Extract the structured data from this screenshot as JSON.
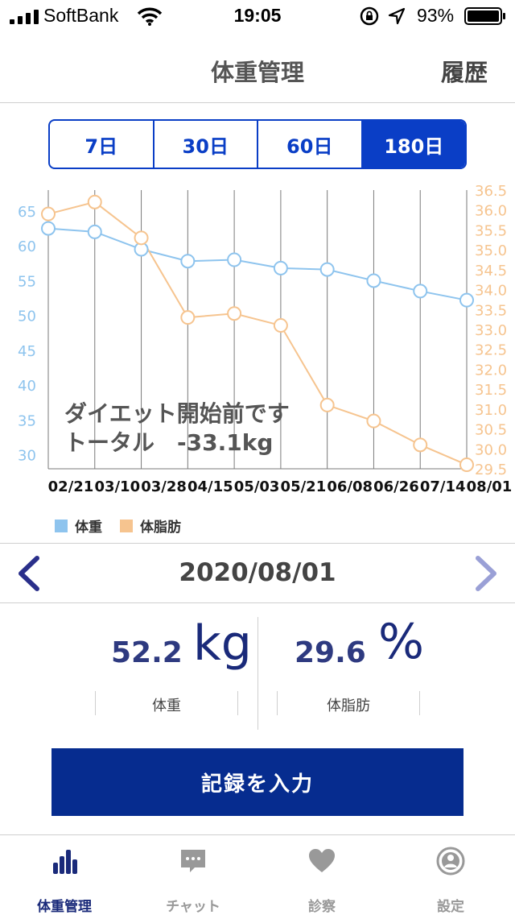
{
  "status_bar": {
    "carrier": "SoftBank",
    "time": "19:05",
    "battery": "93%"
  },
  "header": {
    "title": "体重管理",
    "history_label": "履歴"
  },
  "period_tabs": [
    {
      "label": "7日",
      "active": false
    },
    {
      "label": "30日",
      "active": false
    },
    {
      "label": "60日",
      "active": false
    },
    {
      "label": "180日",
      "active": true
    }
  ],
  "chart_data": {
    "type": "line",
    "categories": [
      "02/21",
      "03/10",
      "03/28",
      "04/15",
      "05/03",
      "05/21",
      "06/08",
      "06/26",
      "07/14",
      "08/01"
    ],
    "series": [
      {
        "name": "体重",
        "axis": "left",
        "color": "#8ec4ee",
        "values": [
          62.5,
          62.0,
          59.5,
          57.8,
          58.0,
          56.8,
          56.6,
          55.0,
          53.5,
          52.2
        ]
      },
      {
        "name": "体脂肪",
        "axis": "right",
        "color": "#f6c48f",
        "values": [
          35.9,
          36.2,
          35.3,
          33.3,
          33.4,
          33.1,
          31.1,
          30.7,
          30.1,
          29.6
        ]
      }
    ],
    "left_axis": {
      "ticks": [
        30,
        35,
        40,
        45,
        50,
        55,
        60,
        65
      ],
      "range": [
        28,
        68
      ]
    },
    "right_axis": {
      "ticks": [
        "29.5",
        "30.0",
        "30.5",
        "31.0",
        "31.5",
        "32.0",
        "32.5",
        "33.0",
        "33.5",
        "34.0",
        "34.5",
        "35.0",
        "35.5",
        "36.0",
        "36.5"
      ],
      "range": [
        29.5,
        36.5
      ]
    },
    "grid": "vertical",
    "overlay_lines": [
      "ダイエット開始前です",
      "トータル　-33.1kg"
    ],
    "legend": [
      {
        "label": "体重",
        "color": "#8ec4ee"
      },
      {
        "label": "体脂肪",
        "color": "#f6c48f"
      }
    ]
  },
  "date_nav": {
    "date": "2020/08/01"
  },
  "metrics": {
    "weight": {
      "value": "52.2",
      "unit": "kg",
      "label": "体重"
    },
    "fat": {
      "value": "29.6",
      "unit": "%",
      "label": "体脂肪"
    }
  },
  "record_button_label": "記録を入力",
  "tab_bar": [
    {
      "label": "体重管理",
      "icon": "bar-chart-icon",
      "active": true
    },
    {
      "label": "チャット",
      "icon": "chat-icon",
      "active": false
    },
    {
      "label": "診察",
      "icon": "heart-icon",
      "active": false
    },
    {
      "label": "設定",
      "icon": "user-circle-icon",
      "active": false
    }
  ],
  "colors": {
    "accent": "#0a3ec6",
    "button": "#062c8f",
    "weight_line": "#8ec4ee",
    "fat_line": "#f6c48f"
  }
}
